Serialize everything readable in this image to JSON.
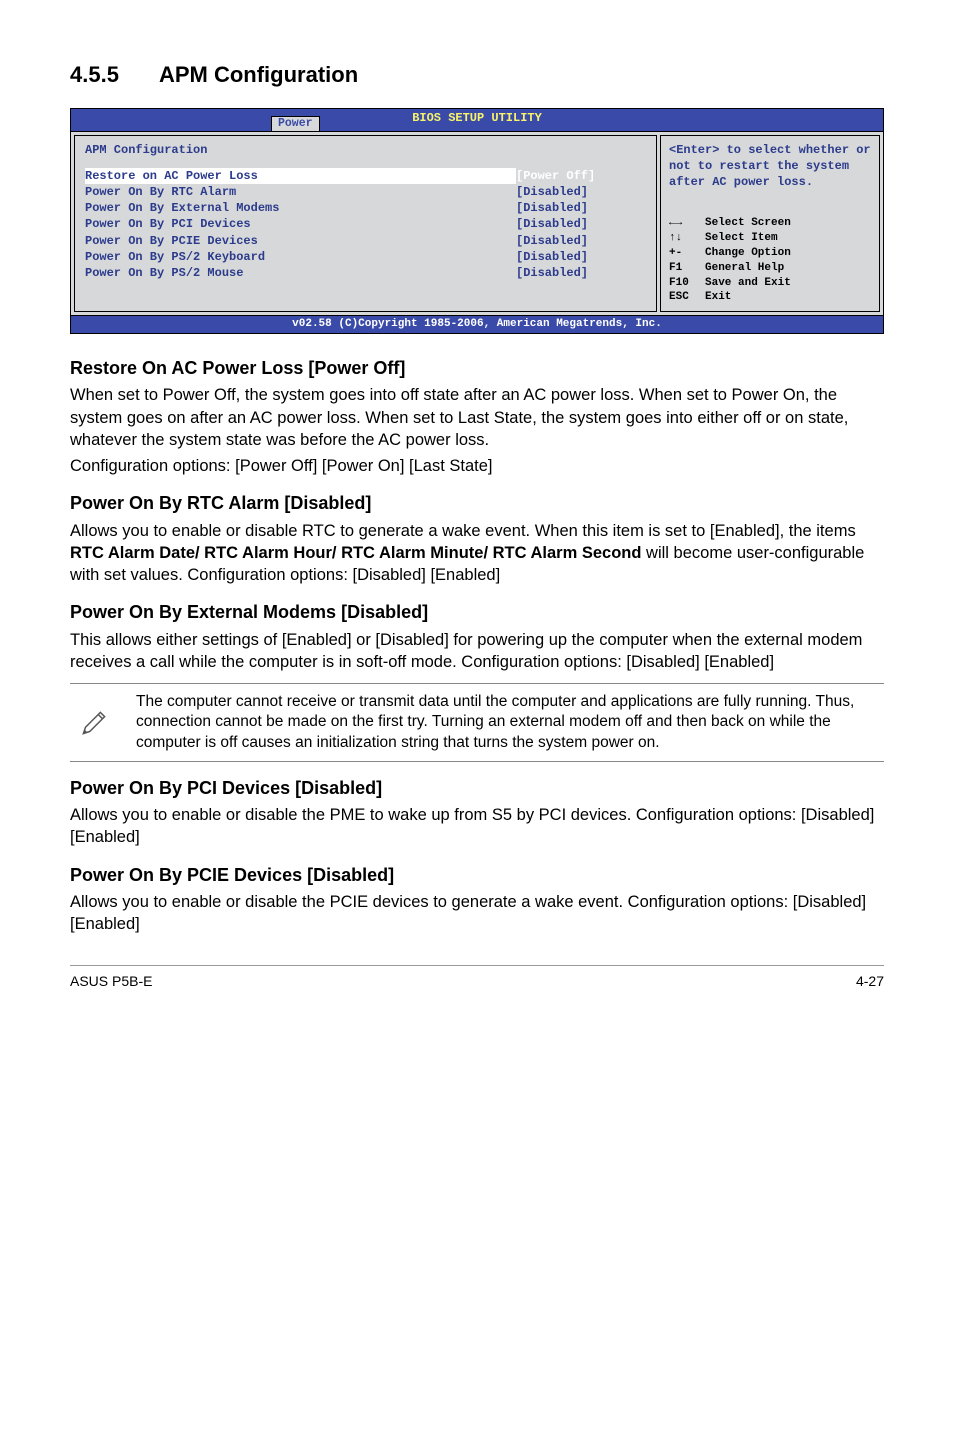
{
  "section": {
    "number": "4.5.5",
    "title": "APM Configuration"
  },
  "bios": {
    "util_title": "BIOS SETUP UTILITY",
    "tab": "Power",
    "panel_title": "APM Configuration",
    "rows": [
      {
        "label": "Restore on AC Power Loss",
        "value": "[Power Off]",
        "selected": true
      },
      {
        "label": "Power On By RTC Alarm",
        "value": "[Disabled]",
        "selected": false
      },
      {
        "label": "Power On By External Modems",
        "value": "[Disabled]",
        "selected": false
      },
      {
        "label": "Power On By PCI Devices",
        "value": "[Disabled]",
        "selected": false
      },
      {
        "label": "Power On By PCIE Devices",
        "value": "[Disabled]",
        "selected": false
      },
      {
        "label": "Power On By PS/2 Keyboard",
        "value": "[Disabled]",
        "selected": false
      },
      {
        "label": "Power On By PS/2 Mouse",
        "value": "[Disabled]",
        "selected": false
      }
    ],
    "help": "<Enter> to select whether or not to restart the system after AC power loss.",
    "nav": {
      "select_screen": "Select Screen",
      "select_item": "Select Item",
      "change_option_key": "+-",
      "change_option": "Change Option",
      "general_help_key": "F1",
      "general_help": "General Help",
      "save_exit_key": "F10",
      "save_exit": "Save and Exit",
      "exit_key": "ESC",
      "exit": "Exit"
    },
    "copyright": "v02.58 (C)Copyright 1985-2006, American Megatrends, Inc."
  },
  "s1": {
    "h": "Restore On AC Power Loss [Power Off]",
    "p": "When set to Power Off, the system goes into off state after an AC power loss. When set to Power On, the system goes on after an AC power loss. When set to Last State, the system goes into either off or on state, whatever the system state was before the AC power loss.",
    "cfg": "Configuration options: [Power Off] [Power On] [Last State]"
  },
  "s2": {
    "h": "Power On By RTC Alarm [Disabled]",
    "p1": "Allows you to enable or disable RTC to generate a wake event. When this item is set to [Enabled], the items ",
    "bold": "RTC Alarm Date/ RTC Alarm Hour/ RTC Alarm Minute/ RTC Alarm Second",
    "p2": " will become user-configurable with set values. Configuration options: [Disabled] [Enabled]"
  },
  "s3": {
    "h": "Power On By External Modems [Disabled]",
    "p": "This allows either settings of [Enabled] or [Disabled] for powering up the computer when the external modem receives a call while the computer is in soft-off mode. Configuration options: [Disabled] [Enabled]"
  },
  "note": "The computer cannot receive or transmit data until the computer and applications are fully running. Thus, connection cannot be made on the first try. Turning an external modem off and then back on while the computer is off causes an initialization string that turns the system power on.",
  "s4": {
    "h": "Power On By PCI Devices [Disabled]",
    "p": "Allows you to enable or disable the PME to wake up from S5 by PCI devices. Configuration options: [Disabled] [Enabled]"
  },
  "s5": {
    "h": "Power On By PCIE Devices [Disabled]",
    "p": "Allows you to enable or disable the PCIE devices to generate a wake event. Configuration options: [Disabled] [Enabled]"
  },
  "footer": {
    "left": "ASUS P5B-E",
    "right": "4-27"
  }
}
